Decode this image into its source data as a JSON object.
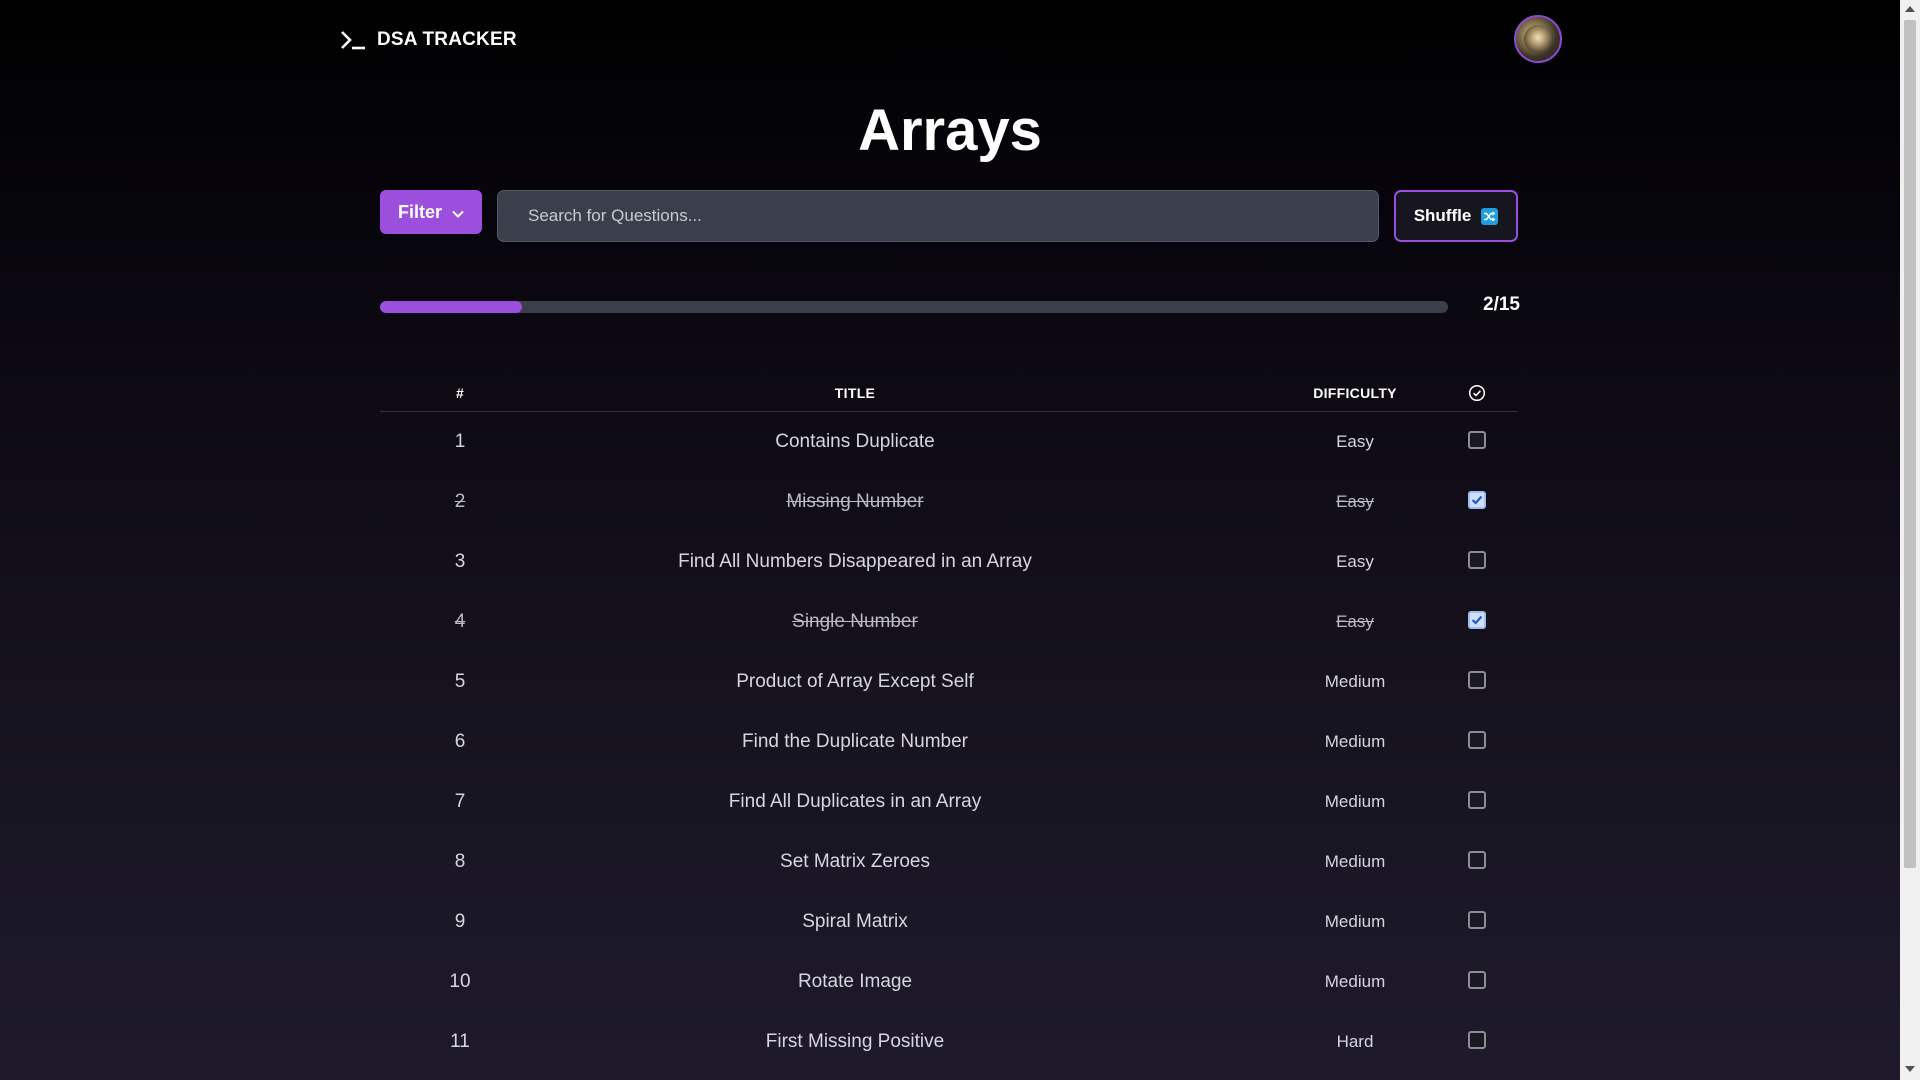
{
  "header": {
    "brand": "DSA TRACKER",
    "brand_icon": "terminal-icon",
    "avatar_icon": "user-avatar"
  },
  "page": {
    "title": "Arrays"
  },
  "controls": {
    "filter_label": "Filter",
    "search_placeholder": "Search for Questions...",
    "shuffle_label": "Shuffle",
    "shuffle_icon": "shuffle-icon"
  },
  "progress": {
    "completed": 2,
    "total": 15,
    "label": "2/15"
  },
  "table": {
    "headers": {
      "num": "#",
      "title": "TITLE",
      "difficulty": "DIFFICULTY",
      "status_icon": "check-circle-icon"
    },
    "rows": [
      {
        "num": "1",
        "title": "Contains Duplicate",
        "difficulty": "Easy",
        "done": false
      },
      {
        "num": "2",
        "title": "Missing Number",
        "difficulty": "Easy",
        "done": true
      },
      {
        "num": "3",
        "title": "Find All Numbers Disappeared in an Array",
        "difficulty": "Easy",
        "done": false
      },
      {
        "num": "4",
        "title": "Single Number",
        "difficulty": "Easy",
        "done": true
      },
      {
        "num": "5",
        "title": "Product of Array Except Self",
        "difficulty": "Medium",
        "done": false
      },
      {
        "num": "6",
        "title": "Find the Duplicate Number",
        "difficulty": "Medium",
        "done": false
      },
      {
        "num": "7",
        "title": "Find All Duplicates in an Array",
        "difficulty": "Medium",
        "done": false
      },
      {
        "num": "8",
        "title": "Set Matrix Zeroes",
        "difficulty": "Medium",
        "done": false
      },
      {
        "num": "9",
        "title": "Spiral Matrix",
        "difficulty": "Medium",
        "done": false
      },
      {
        "num": "10",
        "title": "Rotate Image",
        "difficulty": "Medium",
        "done": false
      },
      {
        "num": "11",
        "title": "First Missing Positive",
        "difficulty": "Hard",
        "done": false
      }
    ]
  },
  "colors": {
    "accent": "#9b4fdc",
    "track": "#3b3f4c",
    "shuffle_icon": "#1f9de0"
  }
}
